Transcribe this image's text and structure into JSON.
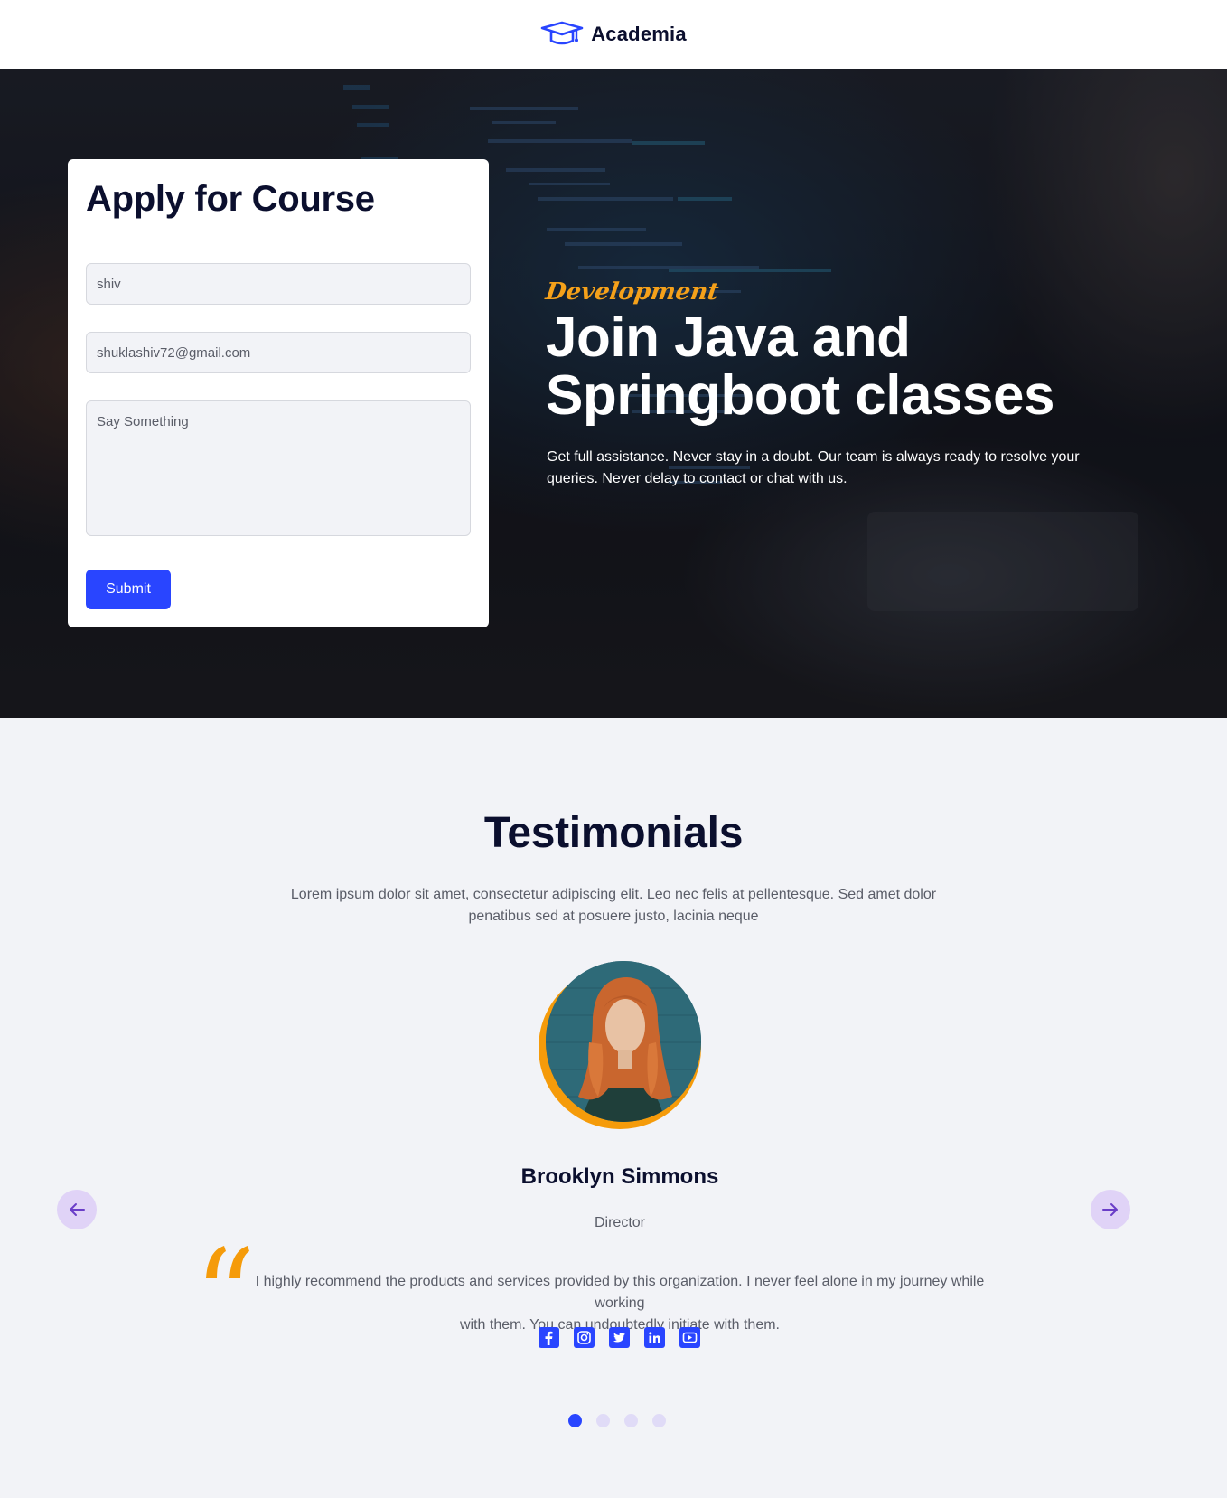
{
  "header": {
    "brand_name": "Academia",
    "logo_icon": "graduation-cap-icon"
  },
  "apply_form": {
    "title": "Apply for Course",
    "name_value": "shiv",
    "email_value": "shuklashiv72@gmail.com",
    "message_placeholder": "Say Something",
    "submit_label": "Submit"
  },
  "hero": {
    "tag": "Development",
    "title_line1": "Join Java and",
    "title_line2": "Springboot classes",
    "description": "Get full assistance. Never stay in a doubt. Our team is always ready to resolve your queries. Never delay to contact or chat with us."
  },
  "testimonials": {
    "title": "Testimonials",
    "subtitle_line1": "Lorem ipsum dolor sit amet, consectetur adipiscing elit. Leo nec felis at pellentesque. Sed amet dolor",
    "subtitle_line2": "penatibus sed at posuere justo, lacinia neque",
    "person_name": "Brooklyn Simmons",
    "person_role": "Director",
    "quote_line1": "I highly recommend the products and services provided by this organization. I never feel alone in my journey while working",
    "quote_line2": "with them. You can undoubtedly initiate with them.",
    "socials": [
      "facebook-icon",
      "instagram-icon",
      "twitter-icon",
      "linkedin-icon",
      "youtube-icon"
    ],
    "slide_count": 4,
    "active_slide": 1
  },
  "colors": {
    "accent": "#2945ff",
    "highlight": "#f59b0a",
    "heading": "#0b0f2e",
    "body_text": "#5a5d68",
    "nav_button_bg": "#e0d3f7"
  }
}
